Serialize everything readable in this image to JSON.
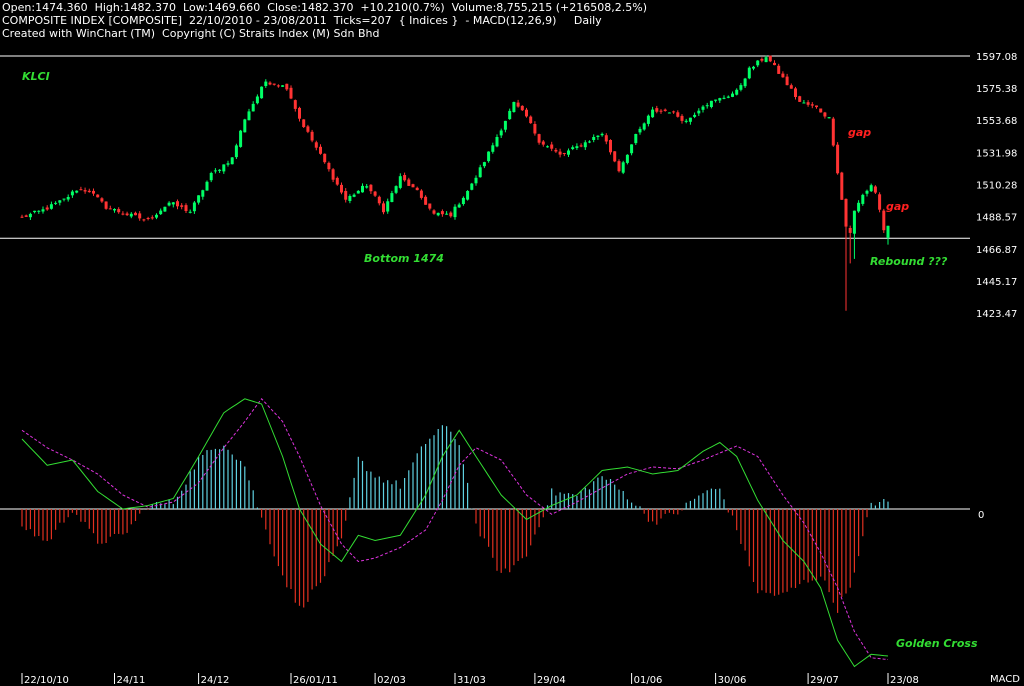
{
  "header": {
    "line1": "Open:1474.360  High:1482.370  Low:1469.660  Close:1482.370  +10.210(0.7%)  Volume:8,755,215 (+216508,2.5%)",
    "line2": "COMPOSITE INDEX [COMPOSITE]  22/10/2010 - 23/08/2011  Ticks=207  { Indices }  - MACD(12,26,9)     Daily",
    "line3": "Created with WinChart (TM)  Copyright (C) Straits Index (M) Sdn Bhd"
  },
  "colors": {
    "background": "#000000",
    "up_candle": "#00ff66",
    "down_candle": "#ff3333",
    "wick": "#ffffff",
    "hist_pos": "#5fd0e0",
    "hist_neg": "#e03020",
    "macd_line": "#33dd33",
    "signal_line": "#dd33dd",
    "annotation_green": "#33dd33",
    "annotation_red": "#ff2020"
  },
  "chart_data": [
    {
      "type": "candlestick",
      "title": "KLCI",
      "y_ticks": [
        "1597.08",
        "1575.38",
        "1553.68",
        "1531.98",
        "1510.28",
        "1488.57",
        "1466.87",
        "1445.17",
        "1423.47"
      ],
      "ylim": [
        1423.47,
        1597.08
      ],
      "x_ticks": [
        "22/10/10",
        "24/11",
        "24/12",
        "26/01/11",
        "02/03",
        "31/03",
        "29/04",
        "01/06",
        "30/06",
        "29/07",
        "23/08"
      ],
      "reference_lines": [
        1597.08,
        1474
      ],
      "last_bar": {
        "open": 1474.36,
        "high": 1482.37,
        "low": 1469.66,
        "close": 1482.37
      },
      "anchors": [
        {
          "x": 0,
          "y": 1488
        },
        {
          "x": 5,
          "y": 1493
        },
        {
          "x": 10,
          "y": 1500
        },
        {
          "x": 13,
          "y": 1507
        },
        {
          "x": 16,
          "y": 1506
        },
        {
          "x": 20,
          "y": 1495
        },
        {
          "x": 25,
          "y": 1490
        },
        {
          "x": 30,
          "y": 1486
        },
        {
          "x": 35,
          "y": 1498
        },
        {
          "x": 40,
          "y": 1492
        },
        {
          "x": 45,
          "y": 1517
        },
        {
          "x": 50,
          "y": 1528
        },
        {
          "x": 53,
          "y": 1555
        },
        {
          "x": 58,
          "y": 1580
        },
        {
          "x": 63,
          "y": 1576
        },
        {
          "x": 66,
          "y": 1555
        },
        {
          "x": 70,
          "y": 1535
        },
        {
          "x": 73,
          "y": 1520
        },
        {
          "x": 77,
          "y": 1500
        },
        {
          "x": 82,
          "y": 1510
        },
        {
          "x": 86,
          "y": 1493
        },
        {
          "x": 90,
          "y": 1515
        },
        {
          "x": 94,
          "y": 1505
        },
        {
          "x": 98,
          "y": 1490
        },
        {
          "x": 102,
          "y": 1490
        },
        {
          "x": 107,
          "y": 1510
        },
        {
          "x": 112,
          "y": 1537
        },
        {
          "x": 117,
          "y": 1565
        },
        {
          "x": 120,
          "y": 1556
        },
        {
          "x": 123,
          "y": 1540
        },
        {
          "x": 128,
          "y": 1530
        },
        {
          "x": 133,
          "y": 1537
        },
        {
          "x": 138,
          "y": 1545
        },
        {
          "x": 142,
          "y": 1520
        },
        {
          "x": 146,
          "y": 1543
        },
        {
          "x": 150,
          "y": 1560
        },
        {
          "x": 154,
          "y": 1560
        },
        {
          "x": 158,
          "y": 1553
        },
        {
          "x": 162,
          "y": 1564
        },
        {
          "x": 166,
          "y": 1568
        },
        {
          "x": 170,
          "y": 1573
        },
        {
          "x": 173,
          "y": 1588
        },
        {
          "x": 177,
          "y": 1597
        },
        {
          "x": 181,
          "y": 1582
        },
        {
          "x": 185,
          "y": 1566
        },
        {
          "x": 189,
          "y": 1562
        },
        {
          "x": 192,
          "y": 1555
        },
        {
          "x": 193,
          "y": 1538
        },
        {
          "x": 195,
          "y": 1500
        },
        {
          "x": 196,
          "y": 1482
        },
        {
          "x": 197,
          "y": 1478
        },
        {
          "x": 198,
          "y": 1492
        },
        {
          "x": 200,
          "y": 1503
        },
        {
          "x": 202,
          "y": 1510
        },
        {
          "x": 203,
          "y": 1505
        },
        {
          "x": 204,
          "y": 1493
        },
        {
          "x": 205,
          "y": 1480
        },
        {
          "x": 206,
          "y": 1482
        }
      ],
      "annotations": [
        {
          "text": "KLCI",
          "color": "green"
        },
        {
          "text": "Bottom 1474",
          "color": "green"
        },
        {
          "text": "gap",
          "color": "red"
        },
        {
          "text": "gap",
          "color": "red"
        },
        {
          "text": "Rebound ???",
          "color": "green"
        }
      ]
    },
    {
      "type": "macd",
      "params": "MACD(12,26,9)",
      "zero_label": "0",
      "axis_label": "MACD",
      "anchors": [
        {
          "x": 0,
          "macd": 4.0,
          "signal": 4.5
        },
        {
          "x": 6,
          "macd": 2.5,
          "signal": 3.5
        },
        {
          "x": 12,
          "macd": 2.8,
          "signal": 2.8
        },
        {
          "x": 18,
          "macd": 1.0,
          "signal": 2.0
        },
        {
          "x": 24,
          "macd": 0.0,
          "signal": 0.8
        },
        {
          "x": 30,
          "macd": 0.2,
          "signal": 0.1
        },
        {
          "x": 36,
          "macd": 0.6,
          "signal": 0.4
        },
        {
          "x": 42,
          "macd": 3.0,
          "signal": 1.5
        },
        {
          "x": 48,
          "macd": 5.5,
          "signal": 3.5
        },
        {
          "x": 53,
          "macd": 6.3,
          "signal": 5.0
        },
        {
          "x": 57,
          "macd": 6.0,
          "signal": 6.3
        },
        {
          "x": 62,
          "macd": 3.0,
          "signal": 5.0
        },
        {
          "x": 66,
          "macd": 0.0,
          "signal": 3.0
        },
        {
          "x": 71,
          "macd": -2.0,
          "signal": 0.2
        },
        {
          "x": 76,
          "macd": -3.0,
          "signal": -2.0
        },
        {
          "x": 80,
          "macd": -1.5,
          "signal": -3.0
        },
        {
          "x": 84,
          "macd": -1.8,
          "signal": -2.8
        },
        {
          "x": 90,
          "macd": -1.5,
          "signal": -2.2
        },
        {
          "x": 96,
          "macd": 0.8,
          "signal": -1.2
        },
        {
          "x": 100,
          "macd": 3.0,
          "signal": 0.5
        },
        {
          "x": 104,
          "macd": 4.5,
          "signal": 2.5
        },
        {
          "x": 108,
          "macd": 3.0,
          "signal": 3.5
        },
        {
          "x": 114,
          "macd": 0.8,
          "signal": 2.8
        },
        {
          "x": 120,
          "macd": -0.6,
          "signal": 0.8
        },
        {
          "x": 126,
          "macd": 0.2,
          "signal": -0.3
        },
        {
          "x": 132,
          "macd": 0.8,
          "signal": 0.4
        },
        {
          "x": 138,
          "macd": 2.2,
          "signal": 1.2
        },
        {
          "x": 144,
          "macd": 2.4,
          "signal": 2.0
        },
        {
          "x": 150,
          "macd": 2.0,
          "signal": 2.4
        },
        {
          "x": 156,
          "macd": 2.2,
          "signal": 2.3
        },
        {
          "x": 162,
          "macd": 3.3,
          "signal": 2.8
        },
        {
          "x": 166,
          "macd": 3.8,
          "signal": 3.2
        },
        {
          "x": 170,
          "macd": 3.0,
          "signal": 3.6
        },
        {
          "x": 175,
          "macd": 0.5,
          "signal": 3.0
        },
        {
          "x": 181,
          "macd": -1.8,
          "signal": 0.8
        },
        {
          "x": 186,
          "macd": -3.0,
          "signal": -0.8
        },
        {
          "x": 190,
          "macd": -4.5,
          "signal": -2.5
        },
        {
          "x": 194,
          "macd": -7.5,
          "signal": -4.5
        },
        {
          "x": 198,
          "macd": -9.0,
          "signal": -7.0
        },
        {
          "x": 202,
          "macd": -8.3,
          "signal": -8.5
        },
        {
          "x": 206,
          "macd": -8.4,
          "signal": -8.6
        }
      ],
      "annotations": [
        {
          "text": "Golden Cross",
          "color": "green"
        }
      ]
    }
  ]
}
